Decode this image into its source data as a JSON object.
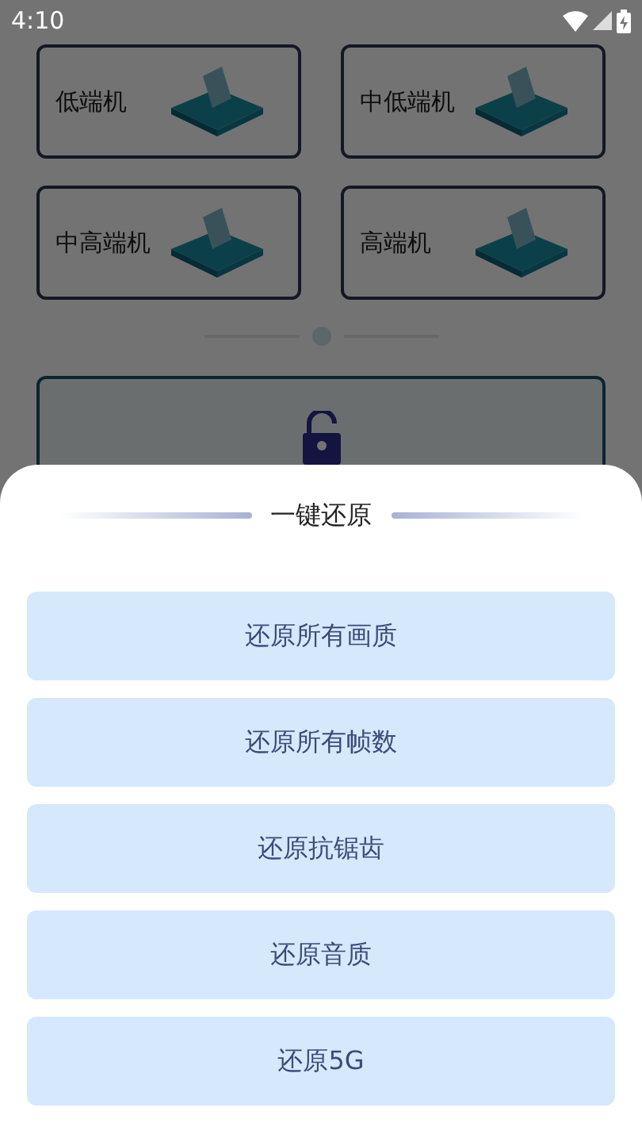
{
  "status_bar": {
    "time": "4:10"
  },
  "device_tiers": [
    {
      "label": "低端机"
    },
    {
      "label": "中低端机"
    },
    {
      "label": "中高端机"
    },
    {
      "label": "高端机"
    }
  ],
  "sheet": {
    "title": "一键还原",
    "buttons": [
      "还原所有画质",
      "还原所有帧数",
      "还原抗锯齿",
      "还原音质",
      "还原5G"
    ]
  }
}
